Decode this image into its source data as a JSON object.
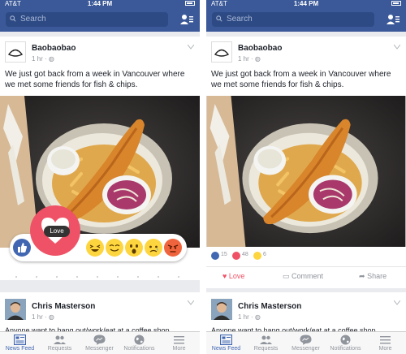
{
  "status": {
    "carrier": "AT&T",
    "time": "1:44 PM"
  },
  "search": {
    "placeholder": "Search"
  },
  "post": {
    "author": "Baobaobao",
    "time": "1 hr",
    "text": "We just got back from a week in Vancouver where we met some friends for fish & chips."
  },
  "reaction_tooltip": "Love",
  "reaction_picker": [
    "like-icon",
    "love-icon",
    "haha-icon",
    "smile-icon",
    "wow-icon",
    "sad-icon",
    "angry-icon"
  ],
  "counts": [
    {
      "icon": "like-icon",
      "value": "15"
    },
    {
      "icon": "love-icon",
      "value": "48"
    },
    {
      "icon": "wow-icon",
      "value": "6"
    }
  ],
  "actions": {
    "love": "Love",
    "comment": "Comment",
    "share": "Share"
  },
  "post2": {
    "author": "Chris Masterson",
    "time": "1 hr",
    "text": "Anyone want to hang out/work/eat at a coffee shop"
  },
  "tabs": [
    {
      "label": "News Feed",
      "active": true
    },
    {
      "label": "Requests"
    },
    {
      "label": "Messenger"
    },
    {
      "label": "Notifications"
    },
    {
      "label": "More"
    }
  ],
  "colors": {
    "brand": "#3b5998",
    "love": "#ef5266",
    "like": "#4267b2",
    "reaction_yellow": "#fdd53f",
    "angry": "#f0643d"
  }
}
